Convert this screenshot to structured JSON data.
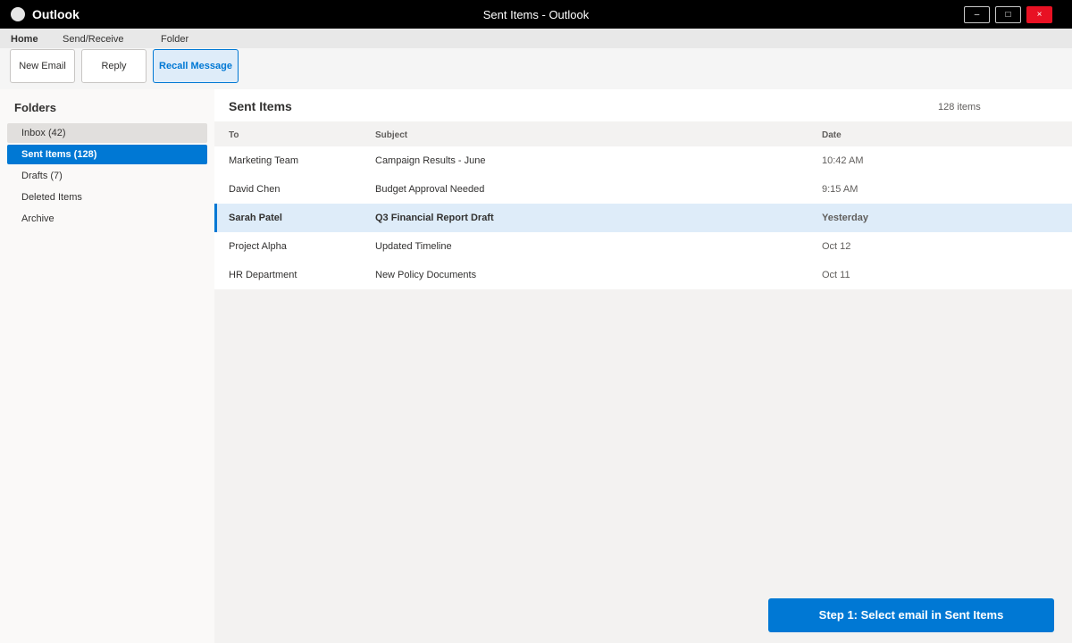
{
  "titlebar": {
    "app_name": "Outlook",
    "window_title": "Sent Items - Outlook",
    "min_label": "–",
    "max_label": "□",
    "close_label": "×"
  },
  "ribbon": {
    "tabs": [
      "Home",
      "Send/Receive",
      "Folder"
    ],
    "buttons": {
      "new_email": "New Email",
      "reply": "Reply",
      "recall": "Recall Message"
    }
  },
  "sidebar": {
    "title": "Folders",
    "folders": [
      "Inbox (42)",
      "Sent Items (128)",
      "Drafts (7)",
      "Deleted Items",
      "Archive"
    ]
  },
  "list": {
    "title": "Sent Items",
    "count": "128 items",
    "columns": {
      "to": "To",
      "subject": "Subject",
      "date": "Date"
    },
    "rows": [
      {
        "to": "Marketing Team",
        "subject": "Campaign Results - June",
        "date": "10:42 AM"
      },
      {
        "to": "David Chen",
        "subject": "Budget Approval Needed",
        "date": "9:15 AM"
      },
      {
        "to": "Sarah Patel",
        "subject": "Q3 Financial Report Draft",
        "date": "Yesterday"
      },
      {
        "to": "Project Alpha",
        "subject": "Updated Timeline",
        "date": "Oct 12"
      },
      {
        "to": "HR Department",
        "subject": "New Policy Documents",
        "date": "Oct 11"
      }
    ]
  },
  "step_banner": "Step 1: Select email in Sent Items",
  "colors": {
    "accent": "#0078d4",
    "selected_row": "#deecf9",
    "close_button": "#e81123"
  }
}
